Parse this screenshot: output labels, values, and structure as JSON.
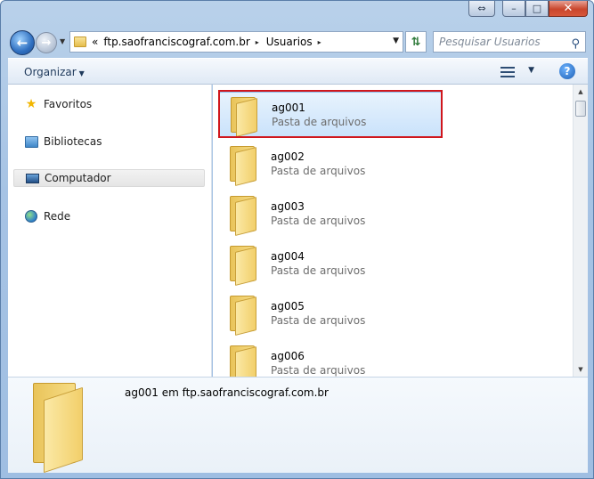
{
  "window": {
    "caption_buttons": {
      "restore": "⇔",
      "minimize": "–",
      "maximize": "□",
      "close": "✕"
    }
  },
  "nav": {
    "back_icon": "arrow-left-icon",
    "forward_icon": "arrow-right-icon",
    "address": {
      "overflow": "«",
      "segments": [
        "ftp.saofranciscograf.com.br",
        "Usuarios"
      ],
      "separator": "▸"
    },
    "search_placeholder": "Pesquisar Usuarios"
  },
  "toolbar": {
    "organize_label": "Organizar",
    "help_label": "?"
  },
  "sidebar": {
    "items": [
      {
        "label": "Favoritos",
        "icon": "star-icon"
      },
      {
        "label": "Bibliotecas",
        "icon": "libraries-icon"
      },
      {
        "label": "Computador",
        "icon": "computer-icon",
        "selected": true
      },
      {
        "label": "Rede",
        "icon": "network-icon"
      }
    ]
  },
  "files": [
    {
      "name": "ag001",
      "type": "Pasta de arquivos",
      "selected": true
    },
    {
      "name": "ag002",
      "type": "Pasta de arquivos"
    },
    {
      "name": "ag003",
      "type": "Pasta de arquivos"
    },
    {
      "name": "ag004",
      "type": "Pasta de arquivos"
    },
    {
      "name": "ag005",
      "type": "Pasta de arquivos"
    },
    {
      "name": "ag006",
      "type": "Pasta de arquivos"
    }
  ],
  "details": {
    "text": "ag001 em ftp.saofranciscograf.com.br"
  },
  "colors": {
    "selection_border": "#d0161c",
    "selection_fill": "#c9e2fb",
    "folder": "#f2cf6a"
  }
}
